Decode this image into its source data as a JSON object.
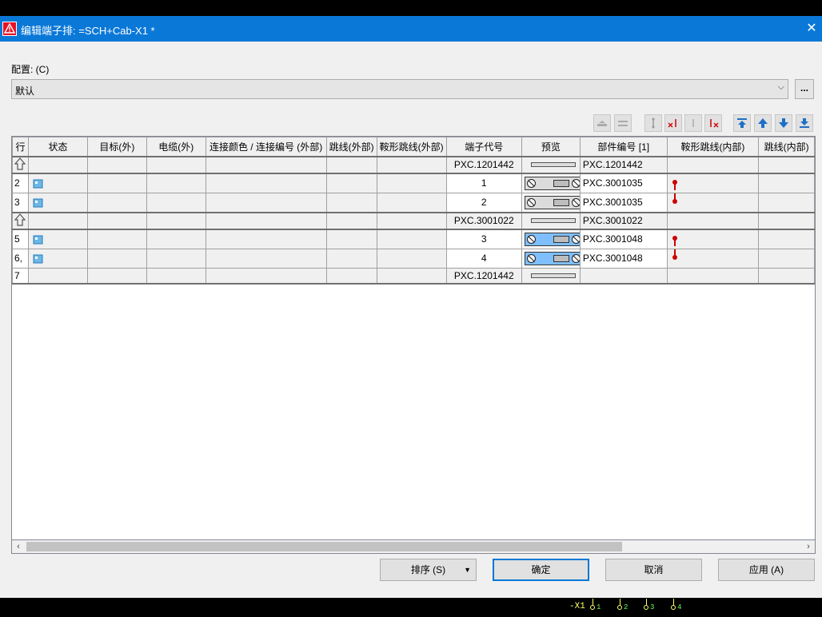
{
  "window": {
    "title": "编辑端子排: =SCH+Cab-X1 *",
    "close_glyph": "✕"
  },
  "config": {
    "label": "配置: (C)",
    "value": "默认",
    "more_label": "..."
  },
  "columns": [
    "行",
    "状态",
    "目标(外)",
    "电缆(外)",
    "连接颜色 / 连接编号 (外部)",
    "跳线(外部)",
    "鞍形跳线(外部)",
    "端子代号",
    "预览",
    "部件编号 [1]",
    "鞍形跳线(内部)",
    "跳线(内部)"
  ],
  "rows": [
    {
      "row": "",
      "kind": "accessory",
      "designation": "PXC.1201442",
      "part": "PXC.1201442"
    },
    {
      "row": "2",
      "kind": "terminal",
      "designation": "1",
      "part": "PXC.3001035",
      "preview": "grey",
      "jumper": "top"
    },
    {
      "row": "3",
      "kind": "terminal",
      "designation": "2",
      "part": "PXC.3001035",
      "preview": "grey",
      "jumper": "bottom"
    },
    {
      "row": "",
      "kind": "accessory",
      "designation": "PXC.3001022",
      "part": "PXC.3001022"
    },
    {
      "row": "5",
      "kind": "terminal",
      "designation": "3",
      "part": "PXC.3001048",
      "preview": "blue",
      "jumper": "top"
    },
    {
      "row": "6,",
      "kind": "terminal",
      "designation": "4",
      "part": "PXC.3001048",
      "preview": "blue",
      "jumper": "bottom"
    },
    {
      "row": "7",
      "kind": "accessory-end",
      "designation": "PXC.1201442",
      "part": ""
    }
  ],
  "buttons": {
    "sort": "排序 (S)",
    "ok": "确定",
    "cancel": "取消",
    "apply": "应用 (A)"
  },
  "footer": {
    "strip_label": "-X1",
    "terminals": [
      "1",
      "2",
      "3",
      "4"
    ]
  },
  "colors": {
    "titlebar": "#0a78d7",
    "selected_terminal": "#7fbfff",
    "jumper": "#cc0000"
  }
}
